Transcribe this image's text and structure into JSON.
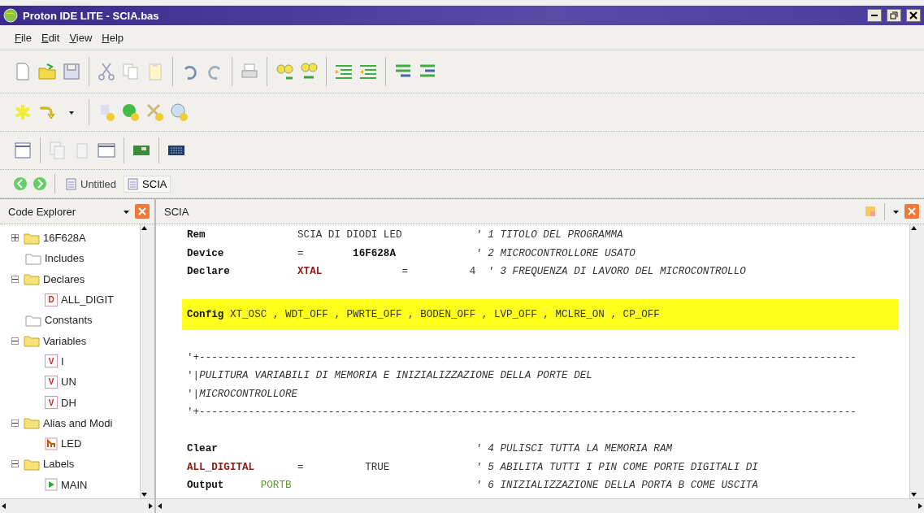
{
  "window": {
    "title": "Proton IDE LITE - SCIA.bas"
  },
  "menu": [
    {
      "label": "File"
    },
    {
      "label": "Edit"
    },
    {
      "label": "View"
    },
    {
      "label": "Help"
    }
  ],
  "document_tabs": [
    {
      "label": "Untitled",
      "selected": false
    },
    {
      "label": "SCIA",
      "selected": true
    }
  ],
  "code_explorer": {
    "title": "Code Explorer",
    "tree": [
      {
        "label": "16F628A",
        "kind": "folder",
        "expanded": false
      },
      {
        "label": "Includes",
        "kind": "empty_folder"
      },
      {
        "label": "Declares",
        "kind": "folder",
        "expanded": true,
        "children": [
          {
            "label": "ALL_DIGIT",
            "kind": "declare",
            "badge": "D"
          }
        ]
      },
      {
        "label": "Constants",
        "kind": "empty_folder"
      },
      {
        "label": "Variables",
        "kind": "folder",
        "expanded": true,
        "children": [
          {
            "label": "I",
            "kind": "variable",
            "badge": "V"
          },
          {
            "label": "UN",
            "kind": "variable",
            "badge": "V"
          },
          {
            "label": "DH",
            "kind": "variable",
            "badge": "V"
          }
        ]
      },
      {
        "label": "Alias and Modi",
        "kind": "folder",
        "expanded": true,
        "children": [
          {
            "label": "LED",
            "kind": "alias"
          }
        ]
      },
      {
        "label": "Labels",
        "kind": "folder",
        "expanded": true,
        "children": [
          {
            "label": "MAIN",
            "kind": "label"
          }
        ]
      }
    ]
  },
  "editor": {
    "title": "SCIA",
    "lines": [
      {
        "highlighted": false,
        "tokens": [
          {
            "kind": "keyword",
            "text": "Rem               "
          },
          {
            "kind": "plain",
            "text": "SCIA DI DIODI LED            "
          },
          {
            "kind": "comment",
            "text": "' 1 TITOLO DEL PROGRAMMA"
          }
        ]
      },
      {
        "highlighted": false,
        "tokens": [
          {
            "kind": "keyword",
            "text": "Device            "
          },
          {
            "kind": "plain",
            "text": "=        "
          },
          {
            "kind": "value",
            "text": "16F628A             "
          },
          {
            "kind": "comment",
            "text": "' 2 MICROCONTROLLORE USATO"
          }
        ]
      },
      {
        "highlighted": false,
        "tokens": [
          {
            "kind": "keyword",
            "text": "Declare           "
          },
          {
            "kind": "constant",
            "text": "XTAL             "
          },
          {
            "kind": "plain",
            "text": "=          4  "
          },
          {
            "kind": "comment",
            "text": "' 3 FREQUENZA DI LAVORO DEL MICROCONTROLLO"
          }
        ]
      },
      {
        "highlighted": false
      },
      {
        "highlighted": true,
        "tokens": [
          {
            "kind": "keyword",
            "text": "Config "
          },
          {
            "kind": "plain",
            "text": "XT_OSC , WDT_OFF , PWRTE_OFF , BODEN_OFF , LVP_OFF , MCLRE_ON , CP_OFF"
          }
        ]
      },
      {
        "highlighted": false
      },
      {
        "highlighted": false,
        "tokens": [
          {
            "kind": "plain",
            "text": "'+-----------------------------------------------------------------------------------------------------------"
          }
        ]
      },
      {
        "highlighted": false,
        "tokens": [
          {
            "kind": "plain",
            "text": "'|"
          },
          {
            "kind": "comment",
            "text": "PULITURA VARIABILI DI MEMORIA E INIZIALIZZAZIONE DELLA PORTE DEL"
          }
        ]
      },
      {
        "highlighted": false,
        "tokens": [
          {
            "kind": "plain",
            "text": "'|"
          },
          {
            "kind": "comment",
            "text": "MICROCONTROLLORE"
          }
        ]
      },
      {
        "highlighted": false,
        "tokens": [
          {
            "kind": "plain",
            "text": "'+-----------------------------------------------------------------------------------------------------------"
          }
        ]
      },
      {
        "highlighted": false
      },
      {
        "highlighted": false,
        "tokens": [
          {
            "kind": "keyword",
            "text": "Clear                                          "
          },
          {
            "kind": "comment",
            "text": "' 4 PULISCI TUTTA LA MEMORIA RAM"
          }
        ]
      },
      {
        "highlighted": false,
        "tokens": [
          {
            "kind": "constant",
            "text": "ALL_DIGITAL       "
          },
          {
            "kind": "plain",
            "text": "=          TRUE              "
          },
          {
            "kind": "comment",
            "text": "' 5 ABILITA TUTTI I PIN COME PORTE DIGITALI DI"
          }
        ]
      },
      {
        "highlighted": false,
        "tokens": [
          {
            "kind": "keyword",
            "text": "Output      "
          },
          {
            "kind": "port",
            "text": "PORTB                              "
          },
          {
            "kind": "comment",
            "text": "' 6 INIZIALIZZAZIONE DELLA PORTA B COME USCITA"
          }
        ]
      }
    ]
  }
}
